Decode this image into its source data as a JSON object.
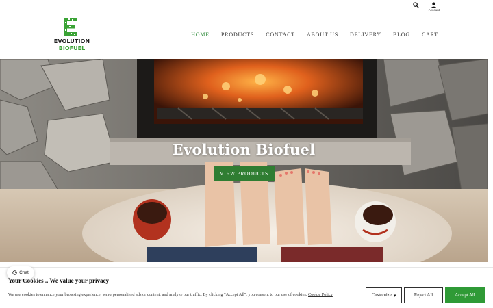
{
  "brand": {
    "line1": "EVOLUTION",
    "line2": "BIOFUEL",
    "green": "#3aa335"
  },
  "top_icons": {
    "search_icon": "search-icon",
    "account_label": "Account"
  },
  "nav": {
    "items": [
      {
        "label": "HOME",
        "active": true
      },
      {
        "label": "PRODUCTS",
        "active": false
      },
      {
        "label": "CONTACT",
        "active": false
      },
      {
        "label": "ABOUT US",
        "active": false
      },
      {
        "label": "DELIVERY",
        "active": false
      },
      {
        "label": "BLOG",
        "active": false
      },
      {
        "label": "CART",
        "active": false
      }
    ],
    "active_color": "#2e8b3a"
  },
  "hero": {
    "title": "Evolution Biofuel",
    "button_label": "VIEW PRODUCTS",
    "button_color": "#2f7d32"
  },
  "chat": {
    "label": "Chat"
  },
  "cookie": {
    "title": "Your Cookies .. We value your privacy",
    "text": "We use cookies to enhance your browsing experience, serve personalized ads or content, and analyze our traffic. By clicking \"Accept All\", you consent to our use of cookies.",
    "link": "Cookie Policy",
    "customize_label": "Customize",
    "reject_label": "Reject All",
    "accept_label": "Accept All",
    "accept_color": "#2f9a36"
  }
}
